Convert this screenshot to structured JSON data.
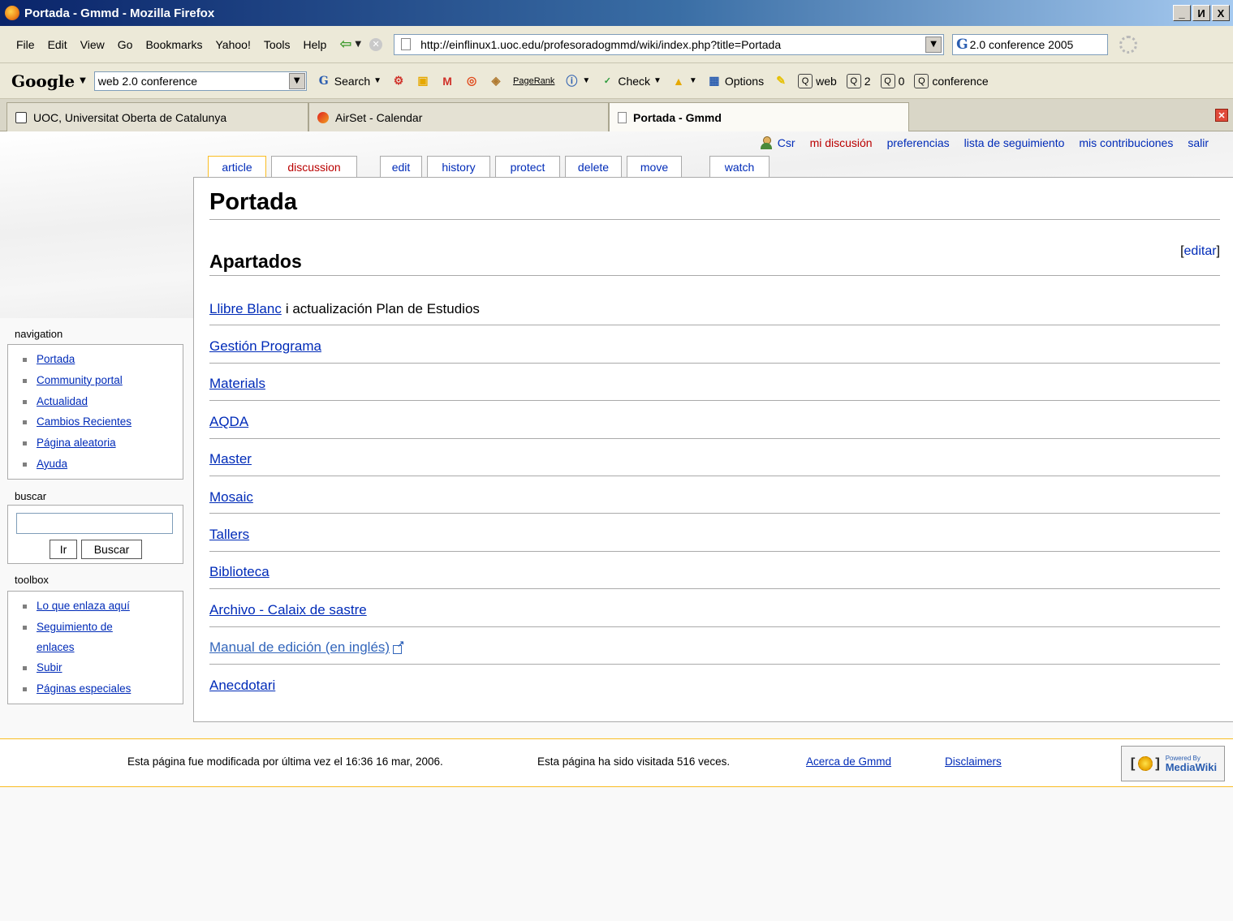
{
  "window": {
    "title": "Portada - Gmmd - Mozilla Firefox",
    "controls": [
      "_",
      "И",
      "X"
    ]
  },
  "menubar": {
    "items": [
      "File",
      "Edit",
      "View",
      "Go",
      "Bookmarks",
      "Yahoo!",
      "Tools",
      "Help"
    ],
    "url": "http://einflinux1.uoc.edu/profesoradogmmd/wiki/index.php?title=Portada",
    "search_value": "2.0 conference 2005"
  },
  "google_toolbar": {
    "logo": "Google",
    "query": "web 2.0 conference",
    "search_label": "Search",
    "pagerank_label": "PageRank",
    "check_label": "Check",
    "options_label": "Options",
    "highlight_terms": [
      "web",
      "2",
      "0",
      "conference"
    ]
  },
  "tabs": [
    {
      "label": "UOC, Universitat Oberta de Catalunya"
    },
    {
      "label": "AirSet - Calendar"
    },
    {
      "label": "Portada - Gmmd"
    }
  ],
  "personal_links": {
    "user": "Csr",
    "talk": "mi discusión",
    "preferences": "preferencias",
    "watchlist": "lista de seguimiento",
    "contributions": "mis contribuciones",
    "logout": "salir"
  },
  "page_tabs": [
    "article",
    "discussion",
    "edit",
    "history",
    "protect",
    "delete",
    "move",
    "watch"
  ],
  "content": {
    "title": "Portada",
    "section": "Apartados",
    "edit_bracket_open": "[",
    "edit_link": "editar",
    "edit_bracket_close": "]",
    "entries": [
      {
        "link": "Llibre Blanc",
        "rest": "i actualización Plan de Estudios"
      },
      {
        "link": "Gestión Programa"
      },
      {
        "link": "Materials"
      },
      {
        "link": "AQDA"
      },
      {
        "link": "Master"
      },
      {
        "link": "Mosaic"
      },
      {
        "link": "Tallers"
      },
      {
        "link": "Biblioteca"
      },
      {
        "link": "Archivo - Calaix de sastre"
      },
      {
        "link": "Manual de edición (en inglés)",
        "external": true
      },
      {
        "link": "Anecdotari"
      }
    ]
  },
  "sidebar": {
    "navigation": {
      "heading": "navigation",
      "items": [
        "Portada",
        "Community portal",
        "Actualidad",
        "Cambios Recientes",
        "Página aleatoria",
        "Ayuda"
      ]
    },
    "search": {
      "heading": "buscar",
      "go_label": "Ir",
      "search_label": "Buscar"
    },
    "toolbox": {
      "heading": "toolbox",
      "items": [
        "Lo que enlaza aquí",
        "Seguimiento de enlaces",
        "Subir",
        "Páginas especiales"
      ]
    }
  },
  "footer": {
    "lastmod": "Esta página fue modificada por última vez el 16:36 16 mar, 2006.",
    "viewcount": "Esta página ha sido visitada 516 veces.",
    "about": "Acerca de Gmmd",
    "disclaimers": "Disclaimers",
    "badge_small": "Powered By",
    "badge_big": "MediaWiki"
  }
}
